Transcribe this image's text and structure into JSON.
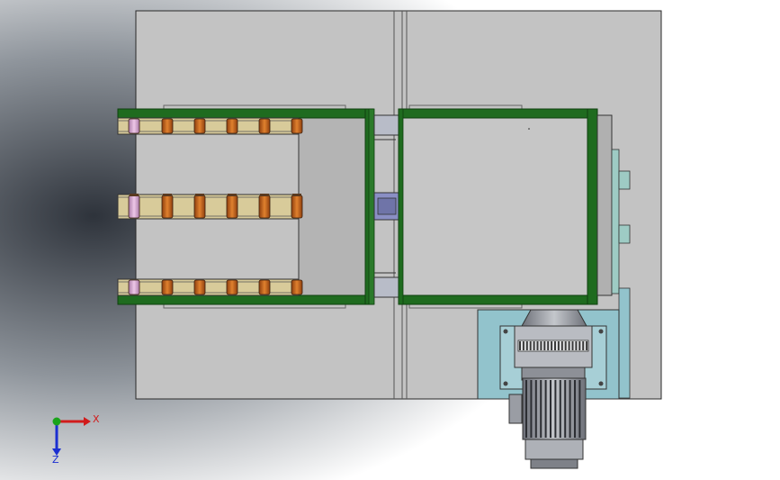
{
  "view": {
    "type": "cad-top-view",
    "background_colors": {
      "vignette": "#2e333b",
      "mid": "#8f959c",
      "light": "#ffffff"
    }
  },
  "colors": {
    "base_plate": "#c0c0c0",
    "plate_edge": "#2a2a2a",
    "frame_green": "#1f6b1f",
    "frame_green_dark": "#0f3f0f",
    "rail_tan": "#d8cb9a",
    "roller_orange": "#c9661c",
    "roller_pink": "#d7a6cf",
    "bracket_purple": "#8a8fc4",
    "motor_mount_blue": "#92c3cc",
    "motor_gray": "#a3a6ad"
  },
  "axis_triad": {
    "x_label": "X",
    "z_label": "Z",
    "x_color": "#d11b1b",
    "y_color": "#1aa31a",
    "z_color": "#1b2fd1"
  }
}
